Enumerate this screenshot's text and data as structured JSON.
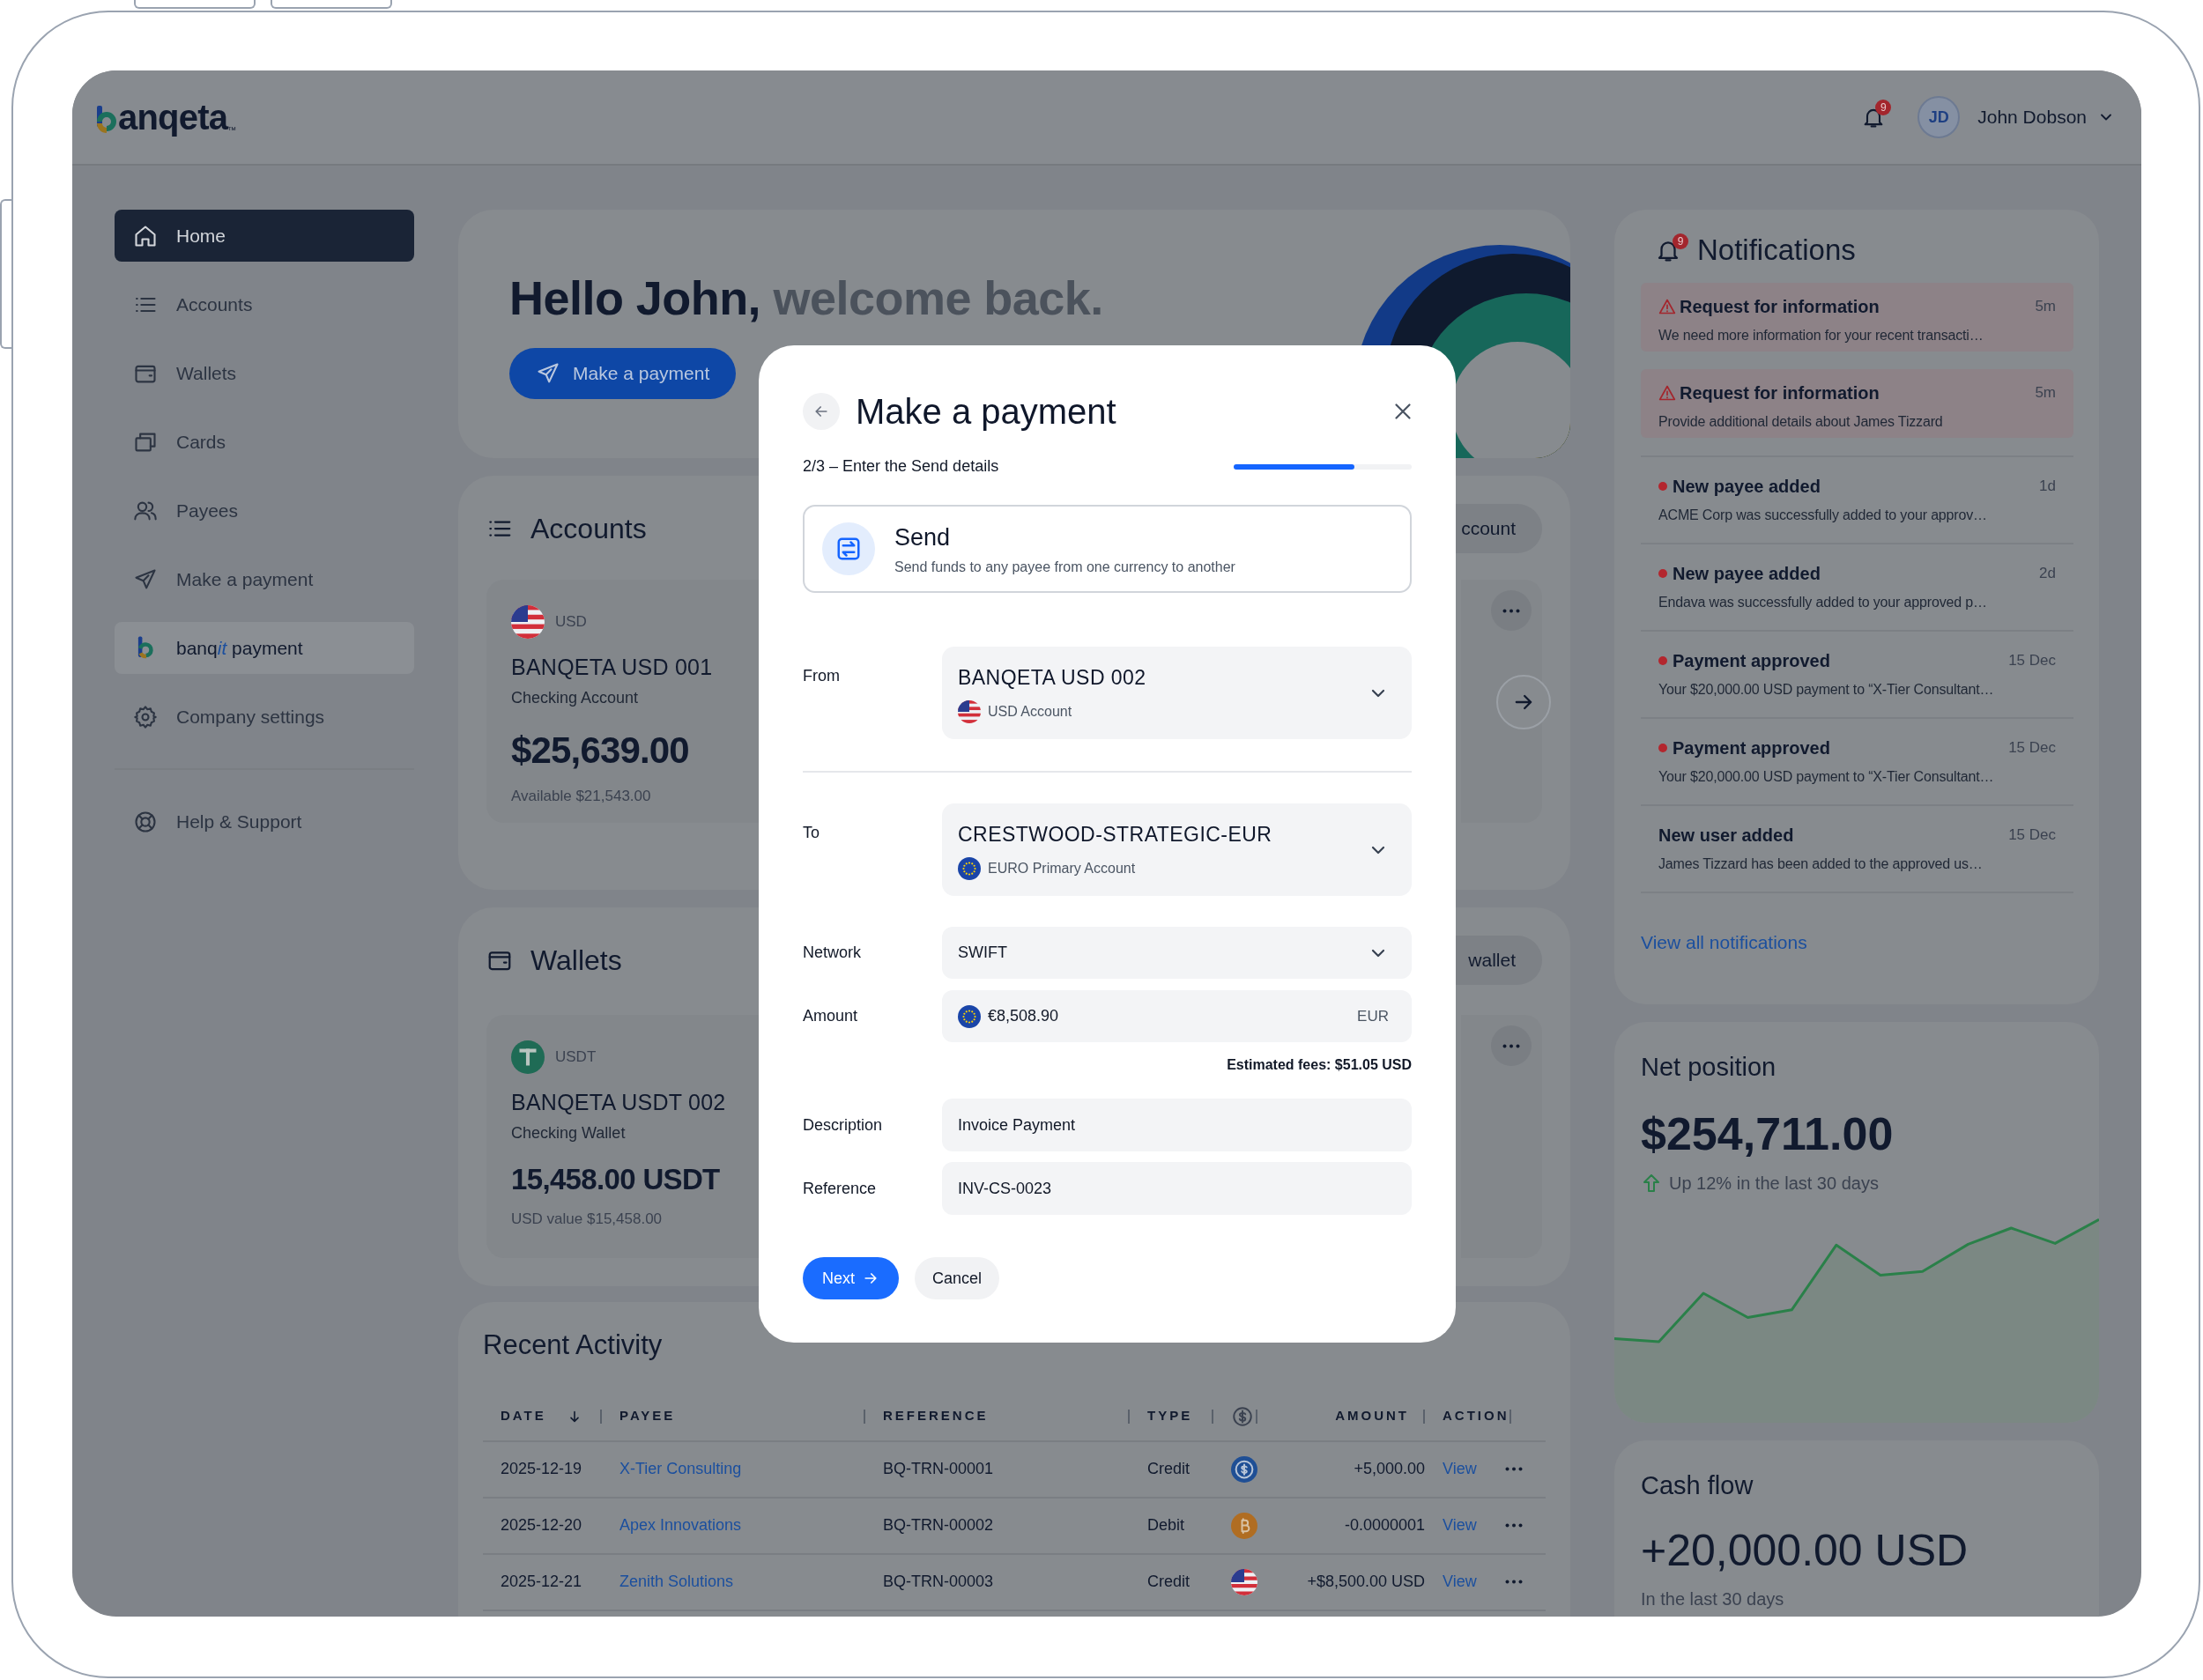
{
  "header": {
    "logo": "anqeta",
    "trademark": "™",
    "notification_count": "9",
    "user_initials": "JD",
    "user_name": "John Dobson"
  },
  "sidebar": {
    "items": [
      {
        "label": "Home",
        "selected": true,
        "featured": false
      },
      {
        "label": "Accounts",
        "selected": false,
        "featured": false
      },
      {
        "label": "Wallets",
        "selected": false,
        "featured": false
      },
      {
        "label": "Cards",
        "selected": false,
        "featured": false
      },
      {
        "label": "Payees",
        "selected": false,
        "featured": false
      },
      {
        "label": "Make a payment",
        "selected": false,
        "featured": false
      },
      {
        "label": "banq",
        "label_italic": "it",
        "label_rest": " payment",
        "selected": false,
        "featured": true
      },
      {
        "label": "Company settings",
        "selected": false,
        "featured": false
      }
    ],
    "footer_items": [
      {
        "label": "Help & Support",
        "selected": false,
        "featured": false
      }
    ]
  },
  "welcome": {
    "greeting": "Hello John,",
    "greeting_rest": "welcome back.",
    "button": "Make a payment"
  },
  "accounts": {
    "title": "Accounts",
    "button": "ccount",
    "card": {
      "kind": "usd",
      "currency": "USD",
      "name": "BANQETA USD 001",
      "type": "Checking Account",
      "balance": "$25,639.00",
      "detail": "Available $21,543.00"
    }
  },
  "wallets": {
    "title": "Wallets",
    "button": "wallet",
    "card": {
      "kind": "usdt",
      "currency": "USDT",
      "name": "BANQETA USDT 002",
      "type": "Checking Wallet",
      "balance": "15,458.00 USDT",
      "detail": "USD value $15,458.00"
    }
  },
  "activity": {
    "title": "Recent Activity",
    "columns": [
      {
        "kind": "text",
        "label": "DATE",
        "sorted": true
      },
      {
        "kind": "text",
        "label": "PAYEE",
        "sorted": false
      },
      {
        "kind": "text",
        "label": "REFERENCE",
        "sorted": false
      },
      {
        "kind": "text",
        "label": "TYPE",
        "sorted": false
      },
      {
        "kind": "icon",
        "sorted": false
      },
      {
        "kind": "amount",
        "label": "AMOUNT",
        "sorted": false
      },
      {
        "kind": "text",
        "label": "ACTION",
        "sorted": false
      }
    ],
    "rows": [
      {
        "kind": "usdc",
        "date": "2025-12-19",
        "payee": "X-Tier Consulting",
        "reference": "BQ-TRN-00001",
        "type": "Credit",
        "amount": "+5,000.00",
        "action": "View"
      },
      {
        "kind": "btc",
        "date": "2025-12-20",
        "payee": "Apex Innovations",
        "reference": "BQ-TRN-00002",
        "type": "Debit",
        "amount": "-0.0000001",
        "action": "View"
      },
      {
        "kind": "usd",
        "date": "2025-12-21",
        "payee": "Zenith Solutions",
        "reference": "BQ-TRN-00003",
        "type": "Credit",
        "amount": "+$8,500.00 USD",
        "action": "View"
      }
    ]
  },
  "notifications": {
    "title": "Notifications",
    "badge": "9",
    "items": [
      {
        "kind": "alert",
        "unread": false,
        "title": "Request for information",
        "time": "5m",
        "text": "We need more information for your recent transacti…"
      },
      {
        "kind": "alert",
        "unread": false,
        "title": "Request for information",
        "time": "5m",
        "text": "Provide additional details about James Tizzard"
      },
      {
        "kind": "info",
        "unread": true,
        "title": "New payee added",
        "time": "1d",
        "text": "ACME Corp was successfully added to your approv…"
      },
      {
        "kind": "info",
        "unread": true,
        "title": "New payee added",
        "time": "2d",
        "text": "Endava was successfully added to your approved p…"
      },
      {
        "kind": "info",
        "unread": true,
        "title": "Payment approved",
        "time": "15 Dec",
        "text": "Your $20,000.00 USD payment to “X-Tier Consultant…"
      },
      {
        "kind": "info",
        "unread": true,
        "title": "Payment approved",
        "time": "15 Dec",
        "text": "Your $20,000.00 USD payment to “X-Tier Consultant…"
      },
      {
        "kind": "info",
        "unread": false,
        "title": "New user added",
        "time": "15 Dec",
        "text": "James Tizzard has been added to the approved us…"
      }
    ],
    "link": "View all notifications"
  },
  "net_position": {
    "title": "Net position",
    "amount": "$254,711.00",
    "change": "Up 12% in the last 30 days"
  },
  "cash_flow": {
    "title": "Cash flow",
    "amount": "+20,000.00 USD",
    "caption": "In the last 30 days"
  },
  "modal": {
    "title": "Make a payment",
    "step": "2/3 – Enter the Send details",
    "level": 0.68,
    "option": {
      "title": "Send",
      "text": "Send funds to any payee from one currency to another"
    },
    "from": {
      "kind": "us",
      "label": "From",
      "name": "BANQETA USD 002",
      "sub": "USD Account"
    },
    "to": {
      "kind": "eu",
      "label": "To",
      "name": "CRESTWOOD-STRATEGIC-EUR",
      "sub": "EURO Primary Account"
    },
    "network": {
      "label": "Network",
      "value": "SWIFT"
    },
    "amount": {
      "kind": "eu",
      "label": "Amount",
      "value": "€8,508.90",
      "currency": "EUR"
    },
    "fees": "Estimated fees: $51.05 USD",
    "description": {
      "label": "Description",
      "value": "Invoice Payment"
    },
    "reference": {
      "label": "Reference",
      "value": "INV-CS-0023"
    },
    "next": "Next",
    "cancel": "Cancel"
  }
}
